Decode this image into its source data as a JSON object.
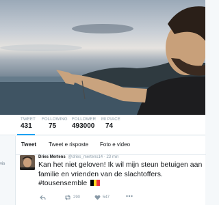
{
  "stats": [
    {
      "label": "TWEET",
      "value": "431"
    },
    {
      "label": "FOLLOWING",
      "value": "75"
    },
    {
      "label": "FOLLOWER",
      "value": "493000"
    },
    {
      "label": "MI PIACE",
      "value": "74"
    }
  ],
  "left_gutter_text": "vis",
  "tabs": [
    {
      "label": "Tweet",
      "active": true
    },
    {
      "label": "Tweet e risposte",
      "active": false
    },
    {
      "label": "Foto e video",
      "active": false
    }
  ],
  "tweet": {
    "name": "Dries Mertens",
    "handle_time": "@dries_mertens14 · 23 min",
    "text": "Kan het niet geloven! Ik wil mijn steun betuigen aan familie en vrienden van de slachtoffers. #tousensemble",
    "retweets": "290",
    "likes": "547"
  },
  "colors": {
    "accent": "#1da1f2",
    "flag": [
      "#000000",
      "#fdda24",
      "#ef3340"
    ]
  },
  "icons": [
    "reply-icon",
    "retweet-icon",
    "heart-icon",
    "more-icon"
  ]
}
